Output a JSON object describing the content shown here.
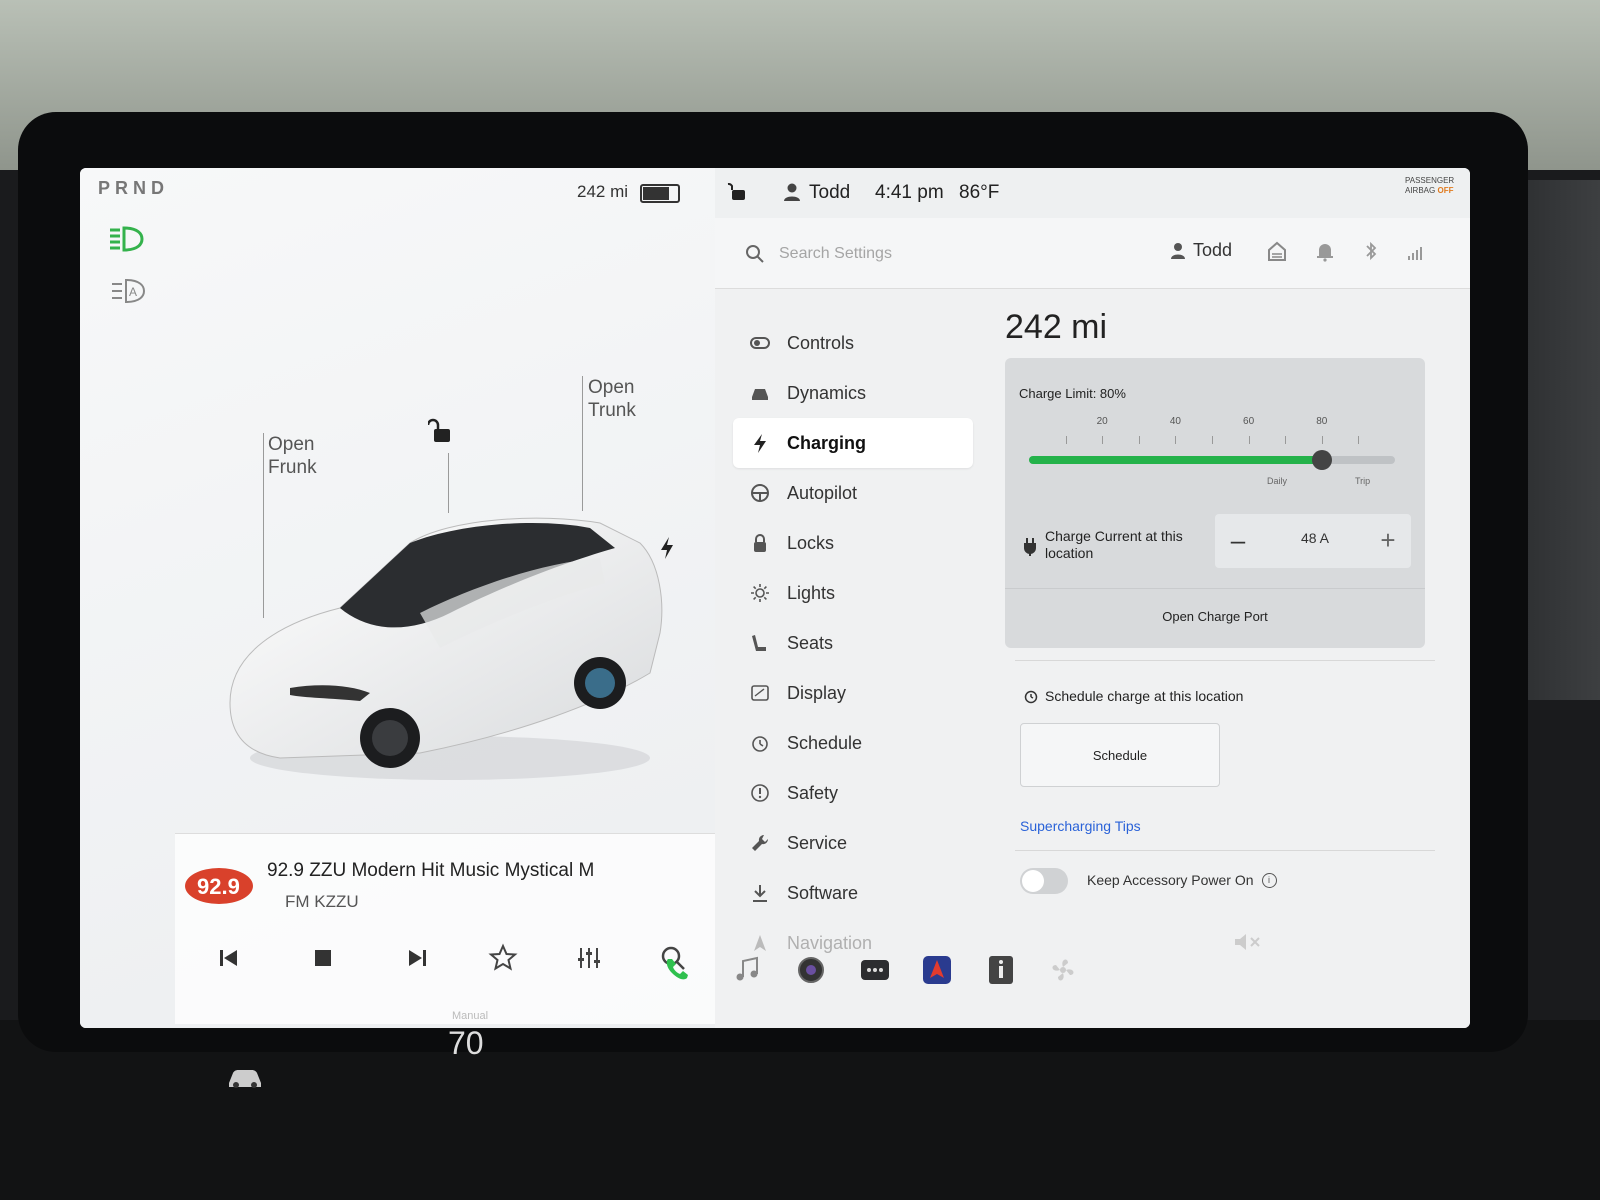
{
  "status": {
    "gear": "PRND",
    "range": "242 mi",
    "battery_level": 0.8,
    "driver": "Todd",
    "time": "4:41 pm",
    "temperature": "86°F",
    "airbag_line1": "PASSENGER",
    "airbag_line2": "AIRBAG",
    "airbag_state": "OFF"
  },
  "car_view": {
    "open_frunk": [
      "Open",
      "Frunk"
    ],
    "open_trunk": [
      "Open",
      "Trunk"
    ]
  },
  "media": {
    "station_logo": "92.9",
    "title": "92.9 ZZU Modern Hit Music Mystical M",
    "band": "FM KZZU"
  },
  "settings": {
    "search_placeholder": "Search Settings",
    "profile": "Todd",
    "nav": [
      {
        "label": "Controls",
        "icon": "toggle-icon"
      },
      {
        "label": "Dynamics",
        "icon": "car-icon"
      },
      {
        "label": "Charging",
        "icon": "bolt-icon"
      },
      {
        "label": "Autopilot",
        "icon": "steering-wheel-icon"
      },
      {
        "label": "Locks",
        "icon": "lock-icon"
      },
      {
        "label": "Lights",
        "icon": "sun-icon"
      },
      {
        "label": "Seats",
        "icon": "seat-icon"
      },
      {
        "label": "Display",
        "icon": "display-icon"
      },
      {
        "label": "Schedule",
        "icon": "alarm-icon"
      },
      {
        "label": "Safety",
        "icon": "alert-icon"
      },
      {
        "label": "Service",
        "icon": "wrench-icon"
      },
      {
        "label": "Software",
        "icon": "download-icon"
      },
      {
        "label": "Navigation",
        "icon": "navigation-icon"
      }
    ],
    "active_nav": "Charging"
  },
  "charging": {
    "range": "242 mi",
    "charge_limit_label": "Charge Limit: 80%",
    "charge_limit": 80,
    "scale_labels": [
      "20",
      "40",
      "60",
      "80"
    ],
    "daily_label": "Daily",
    "trip_label": "Trip",
    "charge_current_label": "Charge Current at this location",
    "charge_current_value": "48 A",
    "minus": "–",
    "plus": "+",
    "open_charge_port": "Open Charge Port",
    "schedule_label": "Schedule charge at this location",
    "schedule_button": "Schedule",
    "supercharging_tips": "Supercharging Tips",
    "keep_accessory_power": "Keep Accessory Power On",
    "keep_accessory_power_on": false
  },
  "climate": {
    "mode": "Manual",
    "temp": "70"
  },
  "colors": {
    "accent_green": "#24b24a",
    "link_blue": "#2a62d8",
    "airbag_orange": "#e07a1f"
  }
}
